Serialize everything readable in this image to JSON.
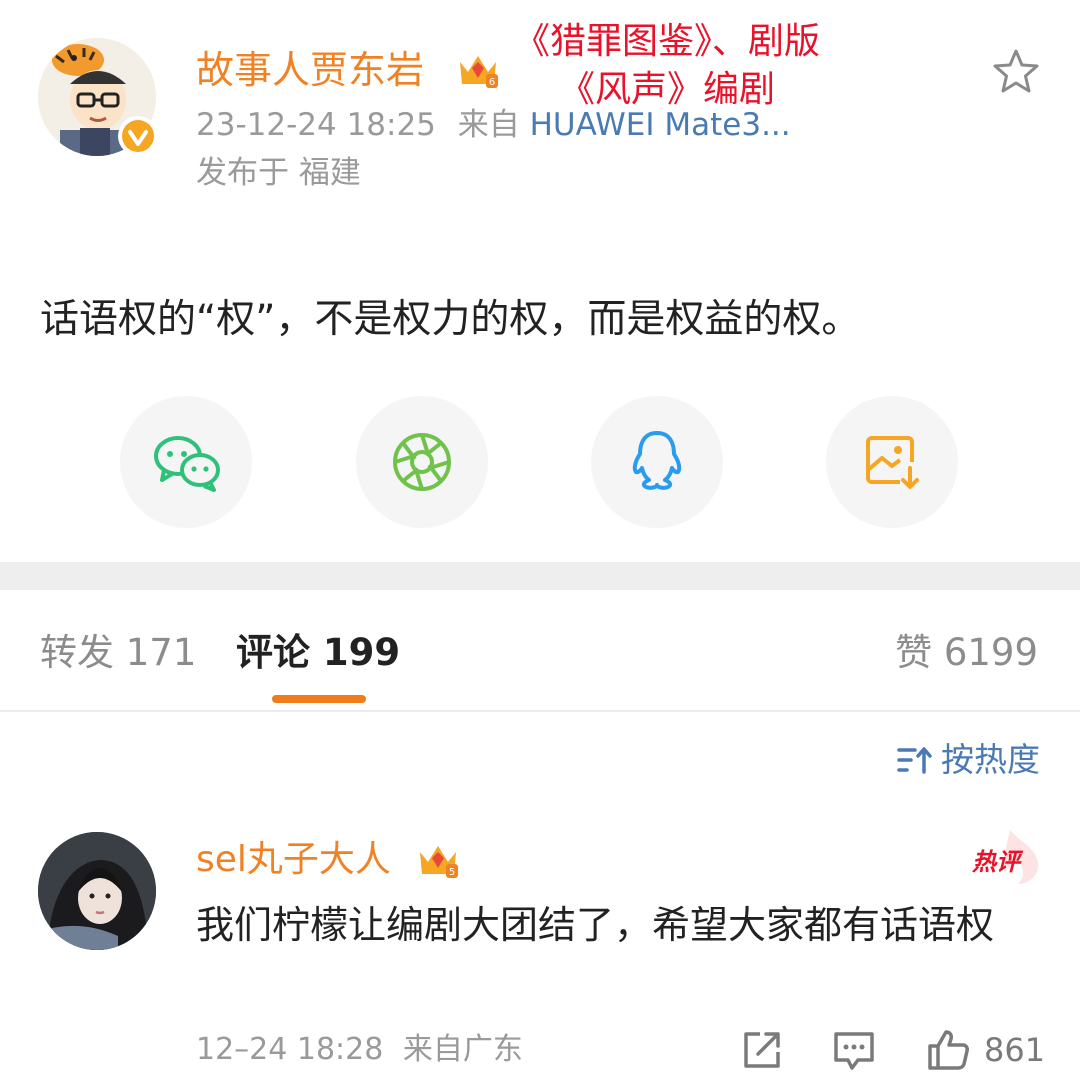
{
  "post": {
    "author_name": "故事人贾东岩",
    "annotation_line1": "《猎罪图鉴》、剧版",
    "annotation_line2": "《风声》编剧",
    "timestamp": "23-12-24 18:25",
    "source_prefix": "来自",
    "device": "HUAWEI Mate3...",
    "location": "发布于 福建",
    "text": "话语权的“权”，不是权力的权，而是权益的权。"
  },
  "share": [
    {
      "icon": "wechat-icon",
      "color": "#2fc179"
    },
    {
      "icon": "moments-icon",
      "color": "#71c24b"
    },
    {
      "icon": "qq-icon",
      "color": "#2a9cf0"
    },
    {
      "icon": "save-image-icon",
      "color": "#f5a623"
    }
  ],
  "tabs": {
    "repost": "转发 171",
    "comment": "评论 199",
    "like": "赞 6199"
  },
  "sort": {
    "label": "按热度"
  },
  "comment": {
    "username": "sel丸子大人",
    "badge": "热评",
    "level": "5",
    "text": "我们柠檬让编剧大团结了，希望大家都有话语权",
    "timestamp": "12–24 18:28",
    "location": "来自广东",
    "likes": "861"
  },
  "colors": {
    "accent": "#f08224",
    "link": "#4a7ab3",
    "annotation": "#e8122a",
    "tab_underline": "#f07c1c"
  }
}
